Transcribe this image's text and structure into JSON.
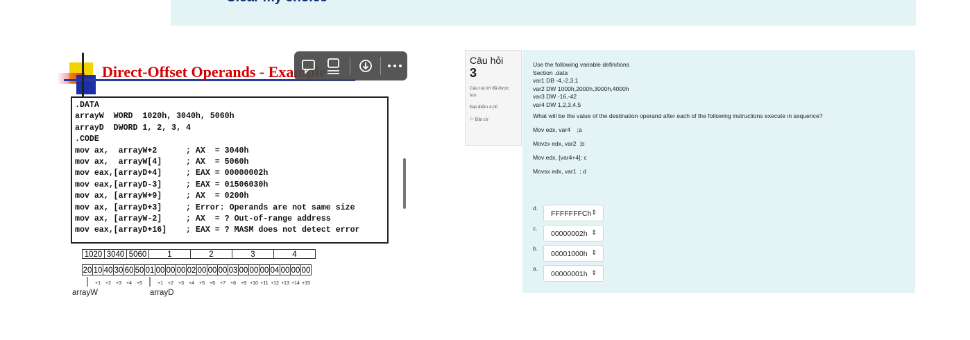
{
  "banner": {
    "clear_choice": "Clear my choice"
  },
  "slide": {
    "title": "Direct-Offset Operands - Example",
    "code_lines": [
      ".DATA",
      "arrayW  WORD  1020h, 3040h, 5060h",
      "arrayD  DWORD 1, 2, 3, 4",
      ".CODE",
      "mov ax,  arrayW+2      ; AX  = 3040h",
      "mov ax,  arrayW[4]     ; AX  = 5060h",
      "mov eax,[arrayD+4]     ; EAX = 00000002h",
      "mov eax,[arrayD-3]     ; EAX = 01506030h",
      "mov ax, [arrayW+9]     ; AX  = 0200h",
      "mov ax, [arrayD+3]     ; Error: Operands are not same size",
      "mov ax, [arrayW-2]     ; AX  = ? Out-of-range address",
      "mov eax,[arrayD+16]    ; EAX = ? MASM does not detect error"
    ],
    "mem_words": [
      "1020",
      "3040",
      "5060",
      "1",
      "2",
      "3",
      "4"
    ],
    "mem_bytes": [
      "20",
      "10",
      "40",
      "30",
      "60",
      "50",
      "01",
      "00",
      "00",
      "00",
      "02",
      "00",
      "00",
      "00",
      "03",
      "00",
      "00",
      "00",
      "04",
      "00",
      "00",
      "00"
    ],
    "offsets_w": [
      "+1",
      "+2",
      "+3",
      "+4",
      "+5"
    ],
    "offsets_d": [
      "+1",
      "+2",
      "+3",
      "+4",
      "+5",
      "+6",
      "+7",
      "+8",
      "+9",
      "+10",
      "+11",
      "+12",
      "+13",
      "+14",
      "+15"
    ],
    "label_arrayW": "arrayW",
    "label_arrayD": "arrayD",
    "toolbar_icons": [
      "comment-icon",
      "add-page-icon",
      "download-icon",
      "more-icon"
    ]
  },
  "question": {
    "title": "Câu hỏi",
    "number": "3",
    "status": "Câu trả lời đã được lưu",
    "mark": "Đạt điểm 4,00",
    "flag": "Đặt cờ",
    "intro_lines": [
      "Use the following variable definitions",
      "Section .data",
      "var1 DB -4,-2,3,1",
      "var2 DW 1000h,2000h,3000h,4000h",
      "var3 DW -16,-42",
      "var4 DW 1,2,3,4,5"
    ],
    "prompt": "What will be the value of the destination operand after each of the following instructions execute in sequence?",
    "instructions": [
      "Mov edx, var4    ;a",
      "Movzx edx, var2  ;b",
      "Mov edx, [var4+4]; c",
      "Movsx edx, var1  ; d"
    ],
    "answers": [
      {
        "letter": "d.",
        "value": "FFFFFFFCh"
      },
      {
        "letter": "c.",
        "value": "00000002h"
      },
      {
        "letter": "b.",
        "value": "00001000h"
      },
      {
        "letter": "a.",
        "value": "00000001h"
      }
    ]
  }
}
